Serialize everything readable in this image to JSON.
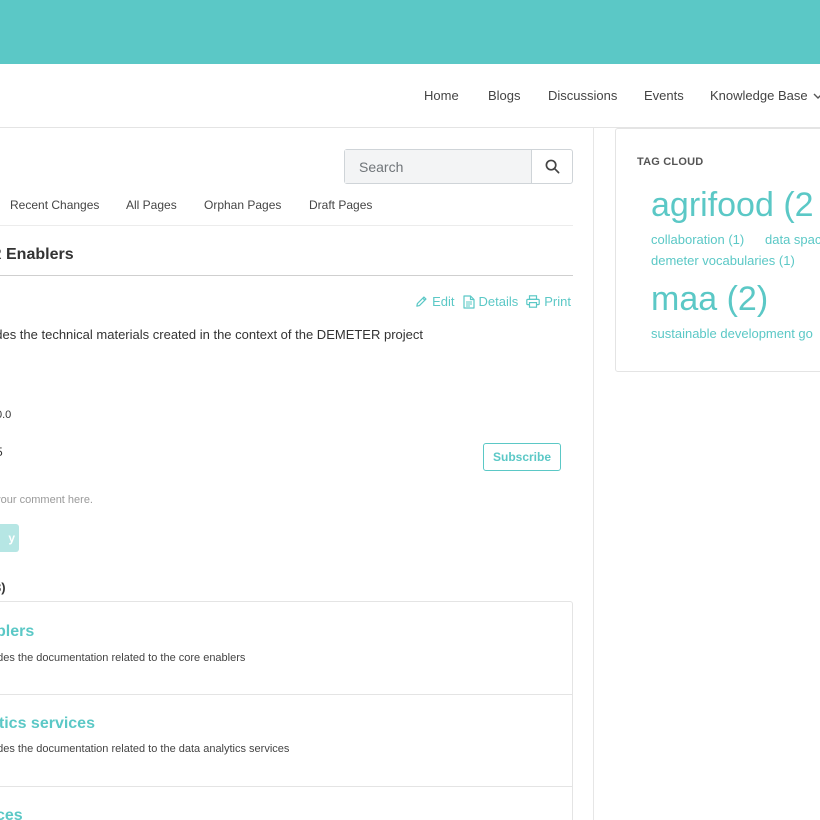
{
  "nav": {
    "items": [
      "Home",
      "Blogs",
      "Discussions",
      "Events",
      "Knowledge Base"
    ]
  },
  "search": {
    "placeholder": "Search"
  },
  "wiki_tabs": [
    "Recent Changes",
    "All Pages",
    "Orphan Pages",
    "Draft Pages"
  ],
  "page": {
    "title": "R Enablers",
    "actions": {
      "edit": "Edit",
      "details": "Details",
      "print": "Print"
    },
    "description": "udes the technical materials created in the context of the DEMETER project",
    "version": "0.0",
    "comments_count": "5"
  },
  "comments": {
    "subscribe_label": "Subscribe",
    "placeholder": "e your comment here.",
    "reply_label": "y"
  },
  "children": {
    "heading": "3)",
    "items": [
      {
        "title": "blers",
        "description": "udes the documentation related to the core enablers"
      },
      {
        "title": "ytics services",
        "description": "udes the documentation related to the data analytics services"
      },
      {
        "title": "ces",
        "description": ""
      }
    ]
  },
  "tag_cloud": {
    "title": "TAG CLOUD",
    "tags": [
      {
        "label": "agrifood (2",
        "size": "xl"
      },
      {
        "label": "collaboration (1)",
        "size": "sm"
      },
      {
        "label": "data spac",
        "size": "sm"
      },
      {
        "label": "demeter vocabularies (1)",
        "size": "sm"
      },
      {
        "label": "maa (2)",
        "size": "xl"
      },
      {
        "label": "sustainable development go",
        "size": "sm"
      }
    ]
  },
  "colors": {
    "brand": "#5bc8c6",
    "reply_disabled": "#b6e6e4"
  }
}
